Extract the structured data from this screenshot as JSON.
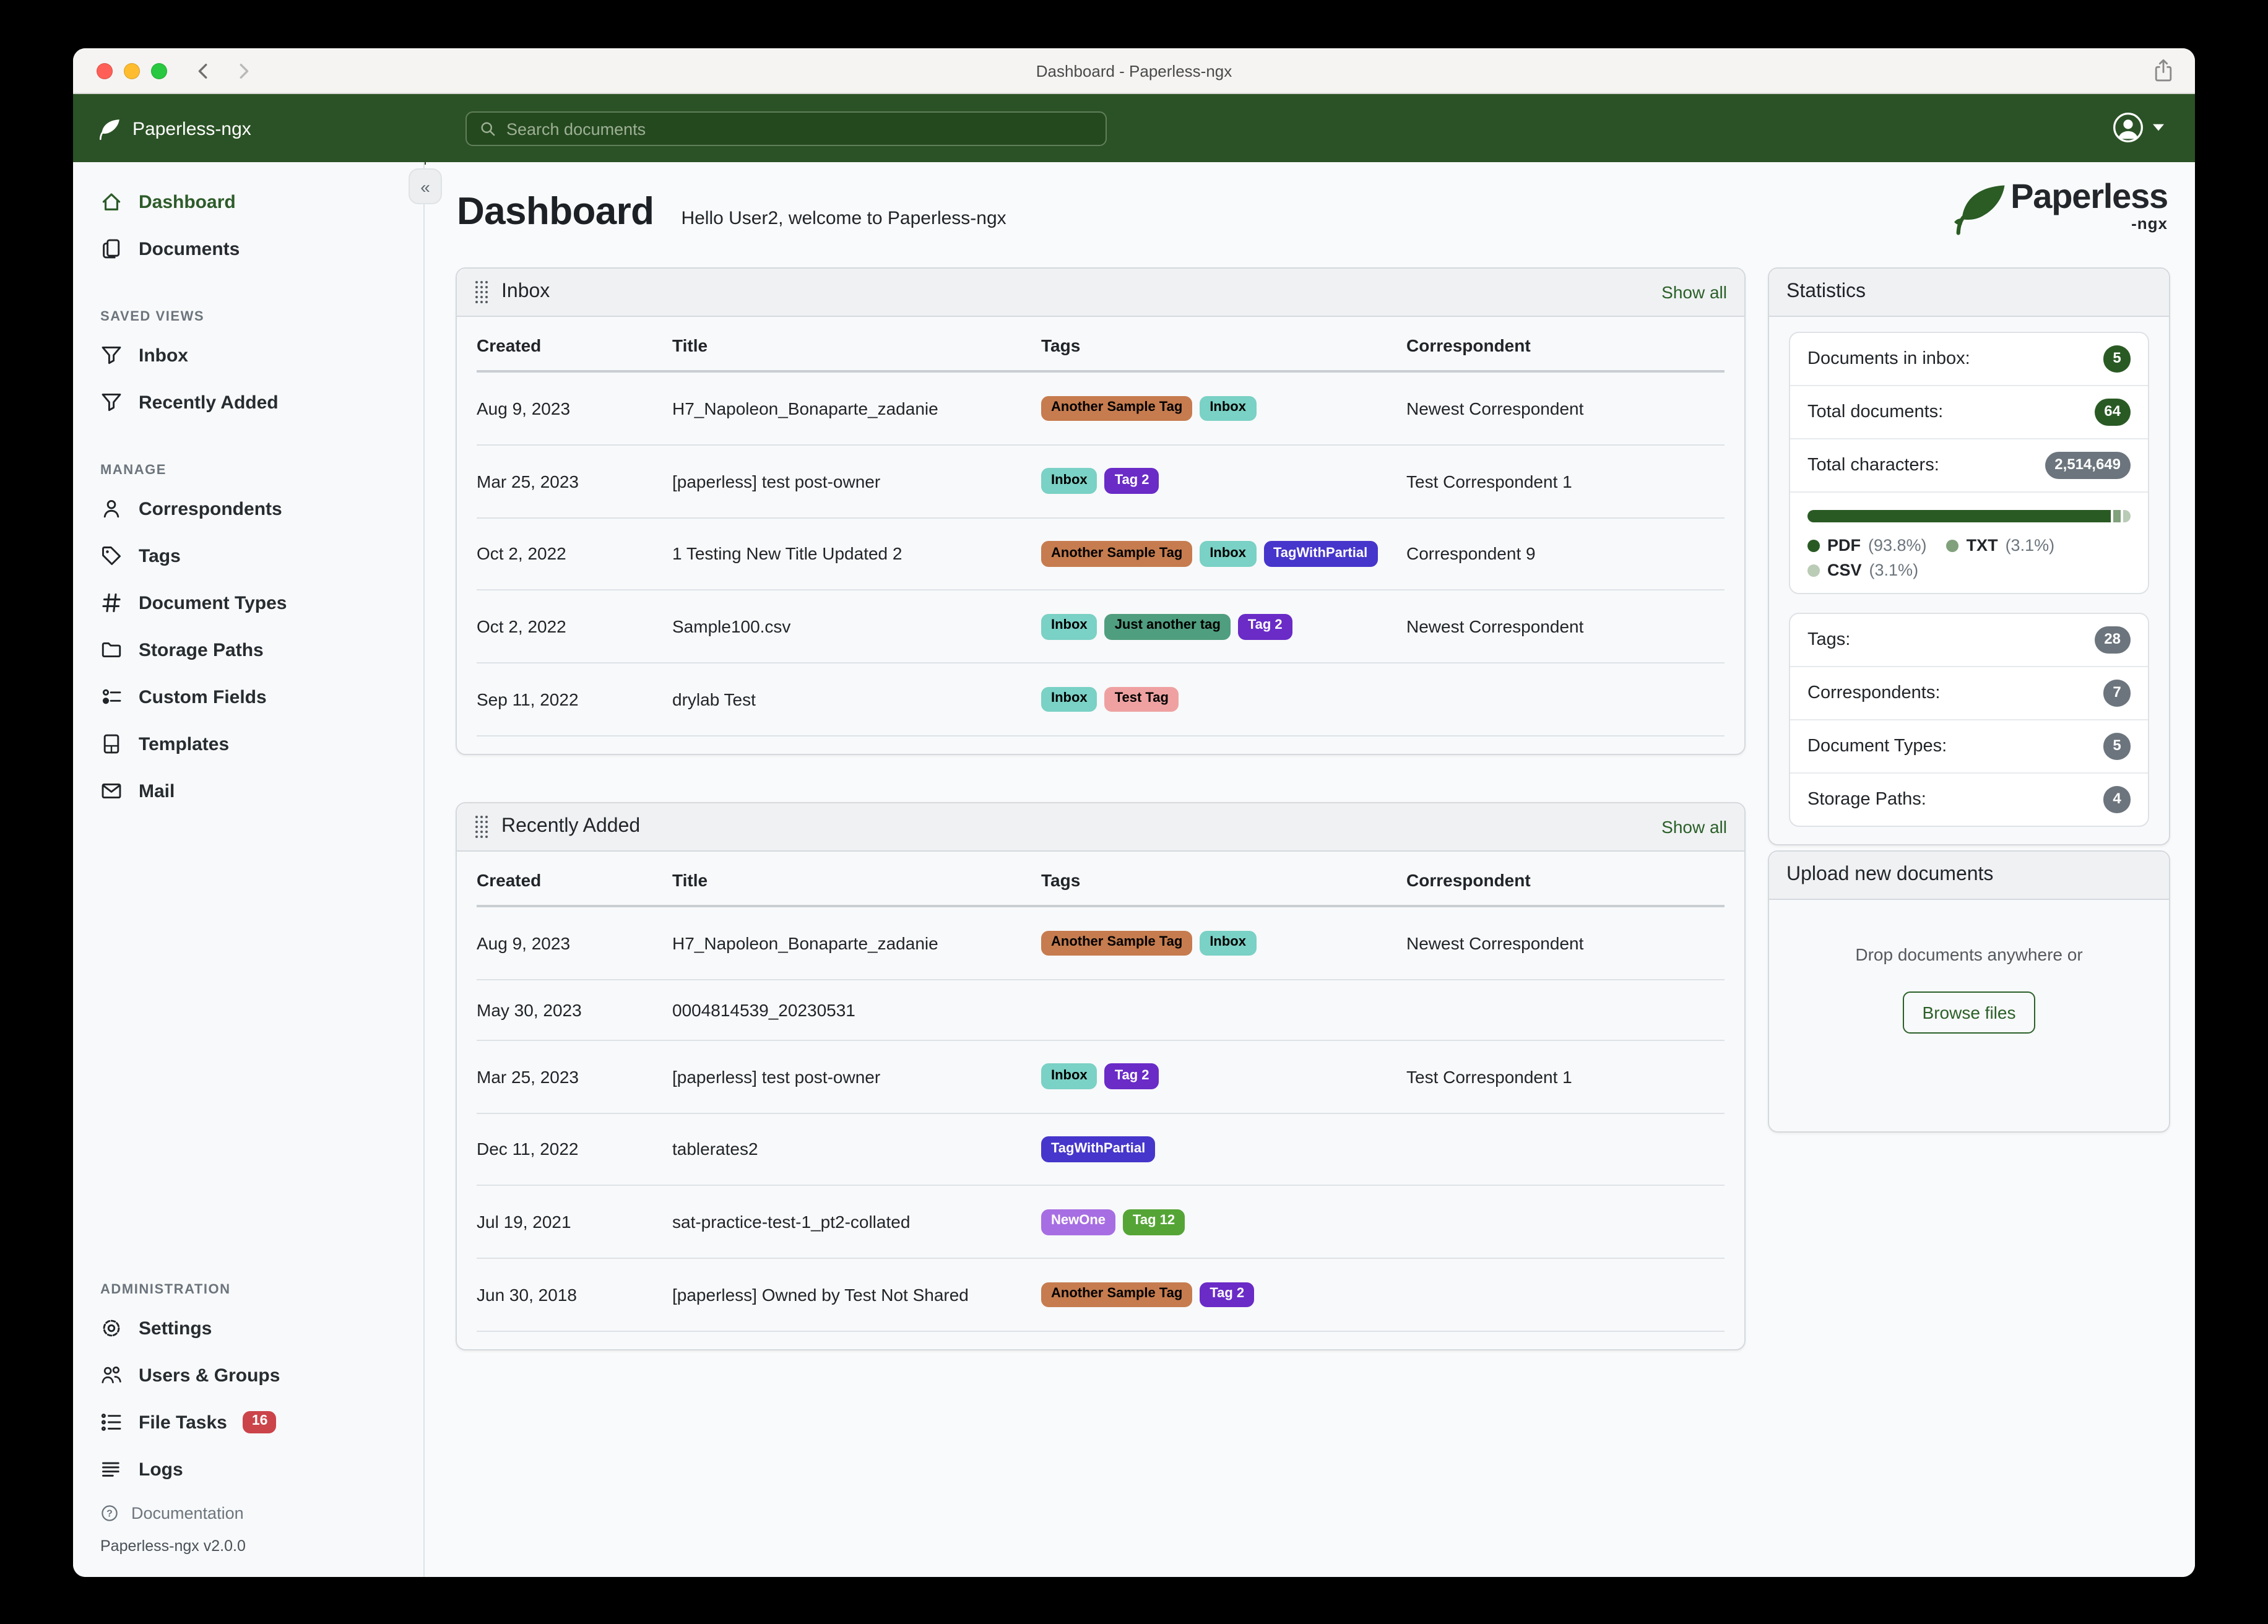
{
  "titlebar": {
    "title": "Dashboard - Paperless-ngx"
  },
  "appbar": {
    "brand": "Paperless-ngx",
    "search_placeholder": "Search documents"
  },
  "sidebar": {
    "sections": [
      {
        "items": [
          {
            "label": "Dashboard",
            "icon": "house",
            "active": true
          },
          {
            "label": "Documents",
            "icon": "files",
            "active": false
          }
        ]
      },
      {
        "title": "SAVED VIEWS",
        "items": [
          {
            "label": "Inbox",
            "icon": "funnel"
          },
          {
            "label": "Recently Added",
            "icon": "funnel"
          }
        ]
      },
      {
        "title": "MANAGE",
        "items": [
          {
            "label": "Correspondents",
            "icon": "person"
          },
          {
            "label": "Tags",
            "icon": "tag"
          },
          {
            "label": "Document Types",
            "icon": "hash"
          },
          {
            "label": "Storage Paths",
            "icon": "folder"
          },
          {
            "label": "Custom Fields",
            "icon": "sliders"
          },
          {
            "label": "Templates",
            "icon": "file"
          },
          {
            "label": "Mail",
            "icon": "envelope"
          }
        ]
      },
      {
        "title": "ADMINISTRATION",
        "push_bottom": true,
        "items": [
          {
            "label": "Settings",
            "icon": "gear"
          },
          {
            "label": "Users & Groups",
            "icon": "people"
          },
          {
            "label": "File Tasks",
            "icon": "list-check",
            "badge": "16"
          },
          {
            "label": "Logs",
            "icon": "justify"
          }
        ]
      }
    ],
    "footer": {
      "documentation_label": "Documentation",
      "version": "Paperless-ngx v2.0.0"
    }
  },
  "main": {
    "page_title": "Dashboard",
    "greeting": "Hello User2, welcome to Paperless-ngx",
    "logo_text": "Paperless",
    "logo_suffix": "-ngx"
  },
  "tag_colors": {
    "Another Sample Tag": {
      "bg": "#c67c4f",
      "fg": "#000000"
    },
    "Inbox": {
      "bg": "#7ad1c5",
      "fg": "#000000"
    },
    "Tag 2": {
      "bg": "#6a2bc7",
      "fg": "#ffffff"
    },
    "TagWithPartial": {
      "bg": "#4636cb",
      "fg": "#ffffff"
    },
    "Just another tag": {
      "bg": "#4f9e7f",
      "fg": "#000000"
    },
    "Test Tag": {
      "bg": "#efa1a1",
      "fg": "#000000"
    },
    "NewOne": {
      "bg": "#a76ee3",
      "fg": "#ffffff"
    },
    "Tag 12": {
      "bg": "#55a536",
      "fg": "#ffffff"
    }
  },
  "cards": [
    {
      "title": "Inbox",
      "show_all": "Show all",
      "columns": [
        "Created",
        "Title",
        "Tags",
        "Correspondent"
      ],
      "rows": [
        {
          "created": "Aug 9, 2023",
          "title": "H7_Napoleon_Bonaparte_zadanie",
          "tags": [
            "Another Sample Tag",
            "Inbox"
          ],
          "correspondent": "Newest Correspondent"
        },
        {
          "created": "Mar 25, 2023",
          "title": "[paperless] test post-owner",
          "tags": [
            "Inbox",
            "Tag 2"
          ],
          "correspondent": "Test Correspondent 1"
        },
        {
          "created": "Oct 2, 2022",
          "title": "1 Testing New Title Updated 2",
          "tags": [
            "Another Sample Tag",
            "Inbox",
            "TagWithPartial"
          ],
          "correspondent": "Correspondent 9"
        },
        {
          "created": "Oct 2, 2022",
          "title": "Sample100.csv",
          "tags": [
            "Inbox",
            "Just another tag",
            "Tag 2"
          ],
          "correspondent": "Newest Correspondent"
        },
        {
          "created": "Sep 11, 2022",
          "title": "drylab Test",
          "tags": [
            "Inbox",
            "Test Tag"
          ],
          "correspondent": ""
        }
      ]
    },
    {
      "title": "Recently Added",
      "show_all": "Show all",
      "columns": [
        "Created",
        "Title",
        "Tags",
        "Correspondent"
      ],
      "rows": [
        {
          "created": "Aug 9, 2023",
          "title": "H7_Napoleon_Bonaparte_zadanie",
          "tags": [
            "Another Sample Tag",
            "Inbox"
          ],
          "correspondent": "Newest Correspondent"
        },
        {
          "created": "May 30, 2023",
          "title": "0004814539_20230531",
          "tags": [],
          "correspondent": ""
        },
        {
          "created": "Mar 25, 2023",
          "title": "[paperless] test post-owner",
          "tags": [
            "Inbox",
            "Tag 2"
          ],
          "correspondent": "Test Correspondent 1"
        },
        {
          "created": "Dec 11, 2022",
          "title": "tablerates2",
          "tags": [
            "TagWithPartial"
          ],
          "correspondent": ""
        },
        {
          "created": "Jul 19, 2021",
          "title": "sat-practice-test-1_pt2-collated",
          "tags": [
            "NewOne",
            "Tag 12"
          ],
          "correspondent": ""
        },
        {
          "created": "Jun 30, 2018",
          "title": "[paperless] Owned by Test Not Shared",
          "tags": [
            "Another Sample Tag",
            "Tag 2"
          ],
          "correspondent": ""
        }
      ]
    }
  ],
  "statistics": {
    "title": "Statistics",
    "summary_rows": [
      {
        "label": "Documents in inbox:",
        "value": "5",
        "color": "green",
        "shape": "circle"
      },
      {
        "label": "Total documents:",
        "value": "64",
        "color": "green",
        "shape": "pill"
      },
      {
        "label": "Total characters:",
        "value": "2,514,649",
        "color": "gray",
        "shape": "pill"
      }
    ],
    "file_types": [
      {
        "name": "PDF",
        "pct": 93.8,
        "pct_label": "(93.8%)",
        "color": "#2a5a24"
      },
      {
        "name": "TXT",
        "pct": 3.1,
        "pct_label": "(3.1%)",
        "color": "#80a17b"
      },
      {
        "name": "CSV",
        "pct": 3.1,
        "pct_label": "(3.1%)",
        "color": "#bacbb6"
      }
    ],
    "count_rows": [
      {
        "label": "Tags:",
        "value": "28",
        "color": "gray",
        "shape": "pill"
      },
      {
        "label": "Correspondents:",
        "value": "7",
        "color": "gray",
        "shape": "circle"
      },
      {
        "label": "Document Types:",
        "value": "5",
        "color": "gray",
        "shape": "circle"
      },
      {
        "label": "Storage Paths:",
        "value": "4",
        "color": "gray",
        "shape": "circle"
      }
    ]
  },
  "upload": {
    "title": "Upload new documents",
    "drop_text": "Drop documents anywhere or",
    "button_label": "Browse files"
  }
}
